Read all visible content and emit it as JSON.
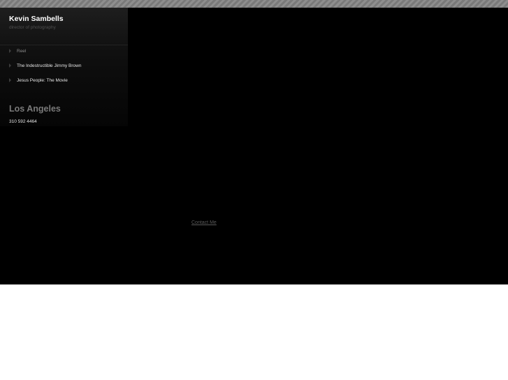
{
  "header": {
    "title": "Kevin Sambells",
    "subtitle": "director of photography"
  },
  "nav": {
    "items": [
      {
        "label": "Reel"
      },
      {
        "label": "The Indestructible Jimmy Brown"
      },
      {
        "label": "Jesus People: The Movie"
      }
    ]
  },
  "contact": {
    "city": "Los Angeles",
    "phone": "310 592 4464",
    "link_label": "Contact Me"
  },
  "colors": {
    "background": "#000000",
    "sidebar": "#121212",
    "title_text": "#ffffff",
    "city_text": "#7a7a7a",
    "link_text": "#5a5a5a"
  },
  "icons": {
    "nav_bullet": "triangle-right-icon"
  }
}
